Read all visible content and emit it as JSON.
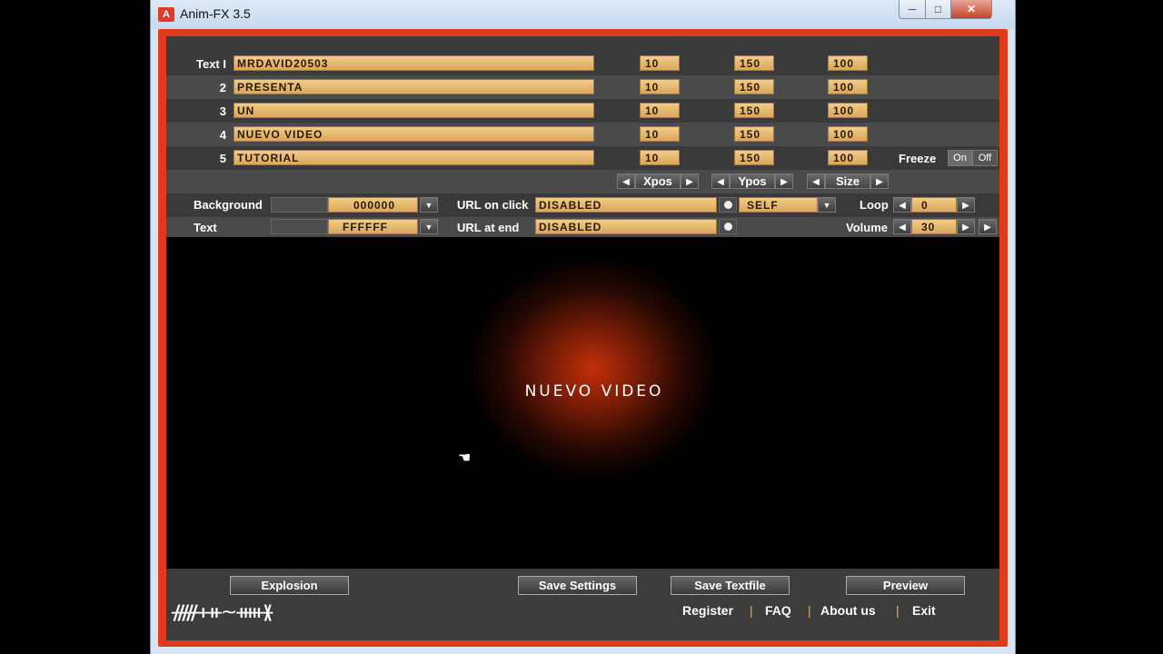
{
  "window": {
    "title": "Anim-FX 3.5",
    "min_glyph": "─",
    "max_glyph": "□",
    "close_glyph": "✕",
    "app_icon": "A"
  },
  "rows": [
    {
      "label": "Text I",
      "text": "MRDAVID20503",
      "xpos": "10",
      "ypos": "150",
      "size": "100"
    },
    {
      "label": "2",
      "text": "PRESENTA",
      "xpos": "10",
      "ypos": "150",
      "size": "100"
    },
    {
      "label": "3",
      "text": "UN",
      "xpos": "10",
      "ypos": "150",
      "size": "100"
    },
    {
      "label": "4",
      "text": "NUEVO VIDEO",
      "xpos": "10",
      "ypos": "150",
      "size": "100"
    },
    {
      "label": "5",
      "text": "TUTORIAL",
      "xpos": "10",
      "ypos": "150",
      "size": "100"
    }
  ],
  "freeze": {
    "label": "Freeze",
    "on": "On",
    "off": "Off"
  },
  "columns": {
    "xpos": "Xpos",
    "ypos": "Ypos",
    "size": "Size"
  },
  "background": {
    "label": "Background",
    "value": "000000"
  },
  "text_color": {
    "label": "Text",
    "value": "FFFFFF"
  },
  "url_click": {
    "label": "URL on click",
    "value": "DISABLED",
    "target": "SELF"
  },
  "url_end": {
    "label": "URL at end",
    "value": "DISABLED"
  },
  "loop": {
    "label": "Loop",
    "value": "0"
  },
  "volume": {
    "label": "Volume",
    "value": "30"
  },
  "stage": {
    "text": "NUEVO VIDEO"
  },
  "buttons": {
    "explosion": "Explosion",
    "save_settings": "Save Settings",
    "save_textfile": "Save Textfile",
    "preview": "Preview"
  },
  "links": {
    "register": "Register",
    "faq": "FAQ",
    "about": "About us",
    "exit": "Exit",
    "separator": "|"
  },
  "icons": {
    "left": "◀",
    "right": "▶",
    "down": "▼",
    "hand": "☚",
    "logo": "ᚏᚐᚑ~ᚔᚕ"
  }
}
